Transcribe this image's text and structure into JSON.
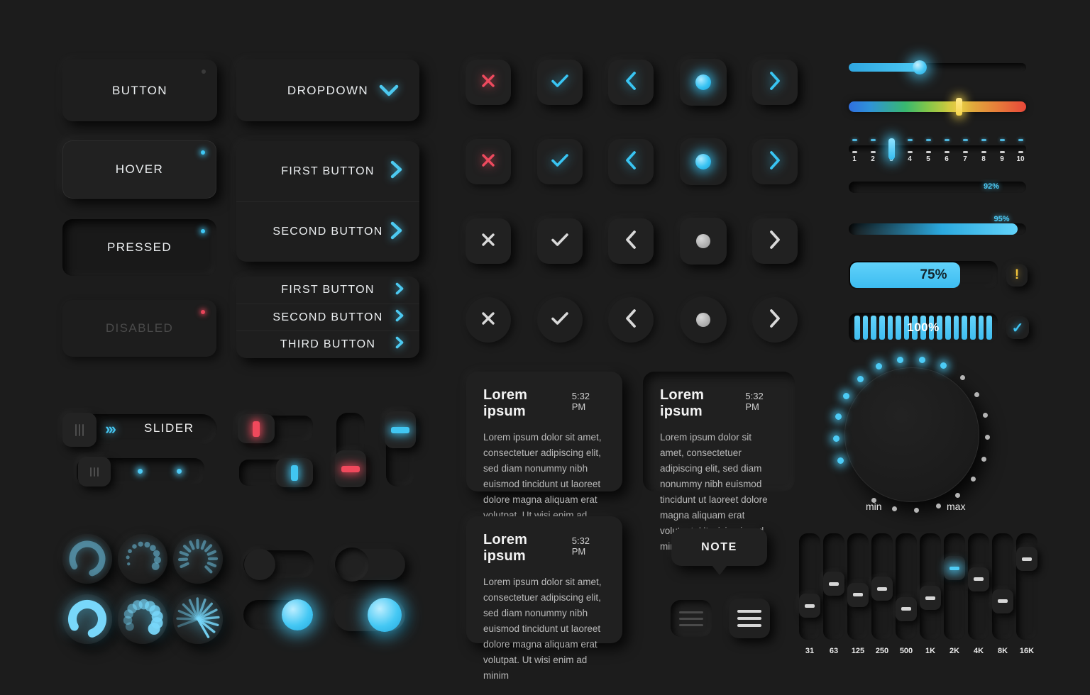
{
  "theme": {
    "background": "#1c1c1c",
    "surface": "#1f1f1f",
    "accent_cyan": "#4cc9f4",
    "accent_red": "#ef4a5e",
    "accent_yellow": "#f5d44a",
    "text_primary": "#eceff1",
    "text_muted": "#b9b9b9",
    "text_disabled": "#4a4a4a"
  },
  "buttons": {
    "normal": {
      "label": "BUTTON",
      "state_dot": "idle"
    },
    "hover": {
      "label": "HOVER",
      "state_dot": "cyan"
    },
    "pressed": {
      "label": "PRESSED",
      "state_dot": "cyan"
    },
    "disabled": {
      "label": "DISABLED",
      "state_dot": "red"
    }
  },
  "dropdown": {
    "label": "DROPDOWN",
    "chevron_icon": "chevron-down-icon",
    "expanded_items": [
      {
        "label": "FIRST BUTTON",
        "icon": "chevron-right-icon"
      },
      {
        "label": "SECOND BUTTON",
        "icon": "chevron-right-icon"
      }
    ],
    "compact_items": [
      {
        "label": "FIRST BUTTON",
        "icon": "chevron-right-icon"
      },
      {
        "label": "SECOND BUTTON",
        "icon": "chevron-right-icon"
      },
      {
        "label": "THIRD BUTTON",
        "icon": "chevron-right-icon"
      }
    ]
  },
  "icon_grid": {
    "columns": [
      "close-icon",
      "check-icon",
      "chevron-left-icon",
      "radio-dot-icon",
      "chevron-right-icon"
    ],
    "glyphs": [
      "✕",
      "✓",
      "‹",
      "●",
      "›"
    ],
    "rows": [
      {
        "shape": "square",
        "style": "raised",
        "colors": [
          "red",
          "cyan",
          "cyan",
          "led-on",
          "cyan"
        ]
      },
      {
        "shape": "square",
        "style": "flat",
        "colors": [
          "red",
          "cyan",
          "cyan",
          "led-on",
          "cyan"
        ]
      },
      {
        "shape": "square",
        "style": "raised",
        "colors": [
          "white",
          "white",
          "white",
          "led-off",
          "white"
        ]
      },
      {
        "shape": "circle",
        "style": "flat",
        "colors": [
          "white",
          "white",
          "white",
          "led-off",
          "white"
        ]
      }
    ]
  },
  "slider_group": {
    "main_slider_label": "SLIDER",
    "grip_icon": "grip-handle-icon",
    "arrows_icon": "double-chevron-right-icon",
    "segment_dots": 2,
    "vertical_toggle_red": "red-indicator",
    "vertical_toggle_cyan": "cyan-indicator",
    "h_toggle_red": "red-indicator",
    "h_toggle_cyan": "cyan-indicator"
  },
  "loaders": [
    {
      "name": "ring-spinner-loader",
      "state": "partial"
    },
    {
      "name": "dot-spinner-loader",
      "state": "partial"
    },
    {
      "name": "dash-spinner-loader",
      "state": "partial"
    },
    {
      "name": "ring-spinner-loader-bright",
      "state": "active"
    },
    {
      "name": "blob-spinner-loader",
      "state": "active"
    },
    {
      "name": "radial-burst-loader",
      "state": "active"
    }
  ],
  "toggles": [
    {
      "name": "toggle-off-inset",
      "state": "off"
    },
    {
      "name": "toggle-off-raised",
      "state": "off"
    },
    {
      "name": "toggle-on-inset",
      "state": "on"
    },
    {
      "name": "toggle-on-raised",
      "state": "on"
    }
  ],
  "cards": [
    {
      "title": "Lorem ipsum",
      "time": "5:32 PM",
      "body": "Lorem ipsum dolor sit amet, consectetuer adipiscing elit, sed diam nonummy nibh euismod tincidunt ut laoreet dolore magna aliquam erat volutpat. Ut wisi enim ad minim"
    },
    {
      "title": "Lorem ipsum",
      "time": "5:32 PM",
      "body": "Lorem ipsum dolor sit amet, consectetuer adipiscing elit, sed diam nonummy nibh euismod tincidunt ut laoreet dolore magna aliquam erat volutpat. Ut wisi enim ad minim"
    },
    {
      "title": "Lorem ipsum",
      "time": "5:32 PM",
      "body": "Lorem ipsum dolor sit amet, consectetuer adipiscing elit, sed diam nonummy nibh euismod tincidunt ut laoreet dolore magna aliquam erat volutpat. Ut wisi enim ad minim"
    }
  ],
  "note_tooltip": {
    "label": "NOTE"
  },
  "menu_buttons": [
    {
      "name": "menu-icon-inset",
      "lines": 3
    },
    {
      "name": "menu-icon-raised",
      "lines": 3
    }
  ],
  "right_panel": {
    "slider_simple": {
      "name": "volume-slider",
      "value": 40,
      "min": 0,
      "max": 100
    },
    "slider_gradient": {
      "name": "color-temperature-slider",
      "value": 62,
      "min": 0,
      "max": 100
    },
    "slider_ticks": {
      "name": "step-slider",
      "value": 3,
      "labels": [
        "1",
        "2",
        "3",
        "4",
        "5",
        "6",
        "7",
        "8",
        "9",
        "10"
      ]
    },
    "progress_thin": {
      "name": "progress-92",
      "value": 92,
      "label": "92%"
    },
    "progress_glow": {
      "name": "progress-95",
      "value": 95,
      "label": "95%"
    },
    "progress_large": {
      "name": "progress-75",
      "value": 75,
      "label": "75%",
      "side_icon": "warning-icon",
      "side_glyph": "!"
    },
    "progress_segmented": {
      "name": "progress-100",
      "value": 100,
      "label": "100%",
      "segments": 17,
      "side_icon": "check-icon",
      "side_glyph": "✓"
    },
    "knob": {
      "name": "rotary-knob",
      "min_label": "min",
      "max_label": "max",
      "total_dots": 20,
      "lit_dots": 9
    },
    "equalizer": {
      "name": "equalizer",
      "bands": [
        {
          "label": "31",
          "value": 28,
          "active": false
        },
        {
          "label": "63",
          "value": 56,
          "active": false
        },
        {
          "label": "125",
          "value": 42,
          "active": false
        },
        {
          "label": "250",
          "value": 50,
          "active": false
        },
        {
          "label": "500",
          "value": 24,
          "active": false
        },
        {
          "label": "1K",
          "value": 38,
          "active": false
        },
        {
          "label": "2K",
          "value": 76,
          "active": true
        },
        {
          "label": "4K",
          "value": 62,
          "active": false
        },
        {
          "label": "8K",
          "value": 34,
          "active": false
        },
        {
          "label": "16K",
          "value": 88,
          "active": false
        }
      ]
    }
  }
}
